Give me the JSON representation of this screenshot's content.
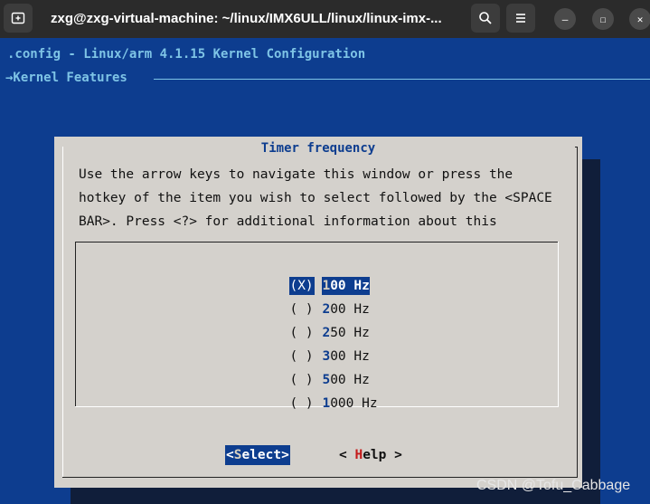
{
  "window": {
    "title": "zxg@zxg-virtual-machine: ~/linux/IMX6ULL/linux/linux-imx-...",
    "newtab_icon": "terminal-new-tab-icon",
    "search_icon": "search-icon",
    "menu_icon": "hamburger-menu-icon",
    "minimize_glyph": "—",
    "maximize_glyph": "☐",
    "close_glyph": "✕"
  },
  "terminal": {
    "config_title": ".config - Linux/arm 4.1.15 Kernel Configuration",
    "breadcrumb": "→Kernel Features"
  },
  "dialog": {
    "title": "Timer frequency",
    "help_lines": [
      "Use the arrow keys to navigate this window or press the",
      "hotkey of the item you wish to select followed by the <SPACE",
      "BAR>. Press <?> for additional information about this"
    ],
    "options": [
      {
        "mark": "(X)",
        "hotkey": "1",
        "rest": "00 Hz"
      },
      {
        "mark": "( )",
        "hotkey": "2",
        "rest": "00 Hz"
      },
      {
        "mark": "( )",
        "hotkey": "2",
        "rest": "50 Hz"
      },
      {
        "mark": "( )",
        "hotkey": "3",
        "rest": "00 Hz"
      },
      {
        "mark": "( )",
        "hotkey": "5",
        "rest": "00 Hz"
      },
      {
        "mark": "( )",
        "hotkey": "1",
        "rest": "000 Hz"
      }
    ],
    "buttons": {
      "select": {
        "pre": "<",
        "hot": "S",
        "post": "elect>"
      },
      "help": {
        "pre": "< ",
        "hot": "H",
        "post": "elp >"
      }
    }
  },
  "watermark": "CSDN @Tofu_Cabbage",
  "colors": {
    "terminal_bg": "#0d3d8f",
    "dialog_bg": "#d4d1cc",
    "accent_text": "#7ec4e6",
    "hotkey_red": "#c41a1a"
  }
}
